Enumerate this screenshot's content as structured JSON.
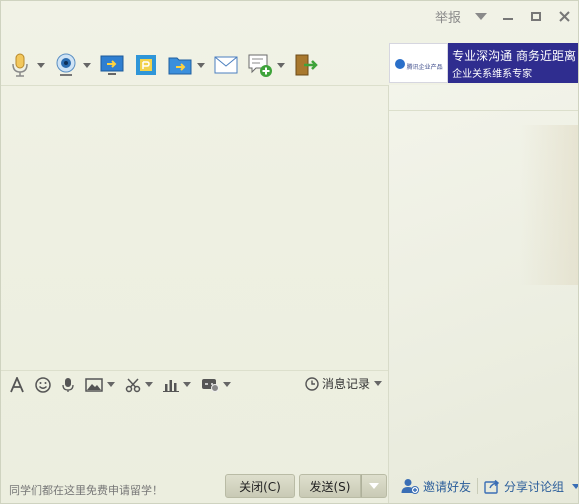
{
  "titlebar": {
    "report_label": "举报"
  },
  "toolbar": {
    "items": [
      {
        "icon": "microphone-icon"
      },
      {
        "icon": "webcam-icon"
      },
      {
        "icon": "screen-share-icon"
      },
      {
        "icon": "whiteboard-icon"
      },
      {
        "icon": "send-file-icon"
      },
      {
        "icon": "email-icon"
      },
      {
        "icon": "create-discussion-icon"
      },
      {
        "icon": "exit-icon"
      }
    ]
  },
  "ad": {
    "logo_text": "腾讯企业产品",
    "line1": "专业深沟通 商务近距离",
    "line2": "企业关系维系专家"
  },
  "input_toolbar": {
    "history_label": "消息记录"
  },
  "bottom": {
    "notice": "同学们都在这里免费申请留学！",
    "close_label": "关闭(C)",
    "send_label": "发送(S)"
  },
  "right_footer": {
    "invite_label": "邀请好友",
    "share_label": "分享讨论组"
  },
  "colors": {
    "ad_bg": "#2f2d8f",
    "link": "#2a5d9a",
    "background": "#eef0e2"
  }
}
